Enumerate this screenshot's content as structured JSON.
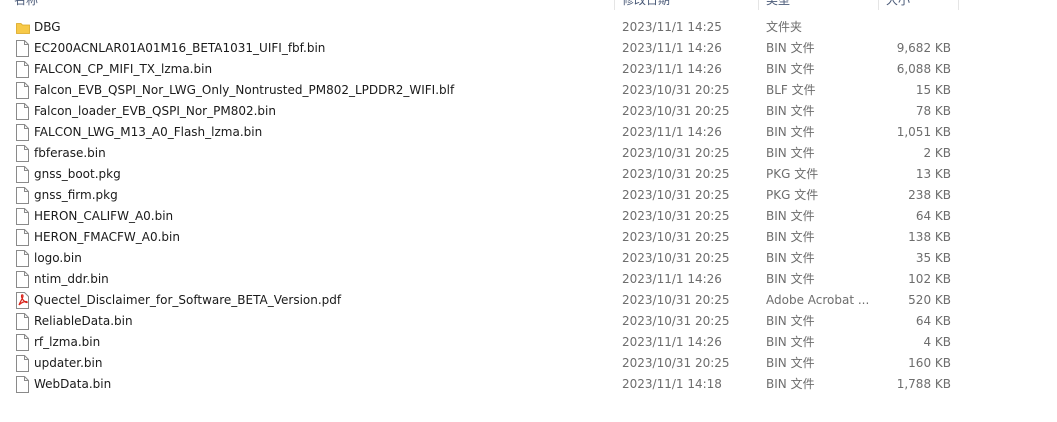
{
  "columns": {
    "name": "名称",
    "date": "修改日期",
    "type": "类型",
    "size": "大小"
  },
  "colors": {
    "folder": "#f7c948",
    "pdf": "#d9241b",
    "file_outline": "#8a8a8a"
  },
  "files": [
    {
      "name": "DBG",
      "date": "2023/11/1 14:25",
      "type": "文件夹",
      "size": "",
      "icon": "folder-icon"
    },
    {
      "name": "EC200ACNLAR01A01M16_BETA1031_UIFI_fbf.bin",
      "date": "2023/11/1 14:26",
      "type": "BIN 文件",
      "size": "9,682 KB",
      "icon": "file-icon"
    },
    {
      "name": "FALCON_CP_MIFI_TX_lzma.bin",
      "date": "2023/11/1 14:26",
      "type": "BIN 文件",
      "size": "6,088 KB",
      "icon": "file-icon"
    },
    {
      "name": "Falcon_EVB_QSPI_Nor_LWG_Only_Nontrusted_PM802_LPDDR2_WIFI.blf",
      "date": "2023/10/31 20:25",
      "type": "BLF 文件",
      "size": "15 KB",
      "icon": "file-icon"
    },
    {
      "name": "Falcon_loader_EVB_QSPI_Nor_PM802.bin",
      "date": "2023/10/31 20:25",
      "type": "BIN 文件",
      "size": "78 KB",
      "icon": "file-icon"
    },
    {
      "name": "FALCON_LWG_M13_A0_Flash_lzma.bin",
      "date": "2023/11/1 14:26",
      "type": "BIN 文件",
      "size": "1,051 KB",
      "icon": "file-icon"
    },
    {
      "name": "fbferase.bin",
      "date": "2023/10/31 20:25",
      "type": "BIN 文件",
      "size": "2 KB",
      "icon": "file-icon"
    },
    {
      "name": "gnss_boot.pkg",
      "date": "2023/10/31 20:25",
      "type": "PKG 文件",
      "size": "13 KB",
      "icon": "file-icon"
    },
    {
      "name": "gnss_firm.pkg",
      "date": "2023/10/31 20:25",
      "type": "PKG 文件",
      "size": "238 KB",
      "icon": "file-icon"
    },
    {
      "name": "HERON_CALIFW_A0.bin",
      "date": "2023/10/31 20:25",
      "type": "BIN 文件",
      "size": "64 KB",
      "icon": "file-icon"
    },
    {
      "name": "HERON_FMACFW_A0.bin",
      "date": "2023/10/31 20:25",
      "type": "BIN 文件",
      "size": "138 KB",
      "icon": "file-icon"
    },
    {
      "name": "logo.bin",
      "date": "2023/10/31 20:25",
      "type": "BIN 文件",
      "size": "35 KB",
      "icon": "file-icon"
    },
    {
      "name": "ntim_ddr.bin",
      "date": "2023/11/1 14:26",
      "type": "BIN 文件",
      "size": "102 KB",
      "icon": "file-icon"
    },
    {
      "name": "Quectel_Disclaimer_for_Software_BETA_Version.pdf",
      "date": "2023/10/31 20:25",
      "type": "Adobe Acrobat ...",
      "size": "520 KB",
      "icon": "pdf-icon"
    },
    {
      "name": "ReliableData.bin",
      "date": "2023/10/31 20:25",
      "type": "BIN 文件",
      "size": "64 KB",
      "icon": "file-icon"
    },
    {
      "name": "rf_lzma.bin",
      "date": "2023/11/1 14:26",
      "type": "BIN 文件",
      "size": "4 KB",
      "icon": "file-icon"
    },
    {
      "name": "updater.bin",
      "date": "2023/10/31 20:25",
      "type": "BIN 文件",
      "size": "160 KB",
      "icon": "file-icon"
    },
    {
      "name": "WebData.bin",
      "date": "2023/11/1 14:18",
      "type": "BIN 文件",
      "size": "1,788 KB",
      "icon": "file-icon"
    }
  ]
}
